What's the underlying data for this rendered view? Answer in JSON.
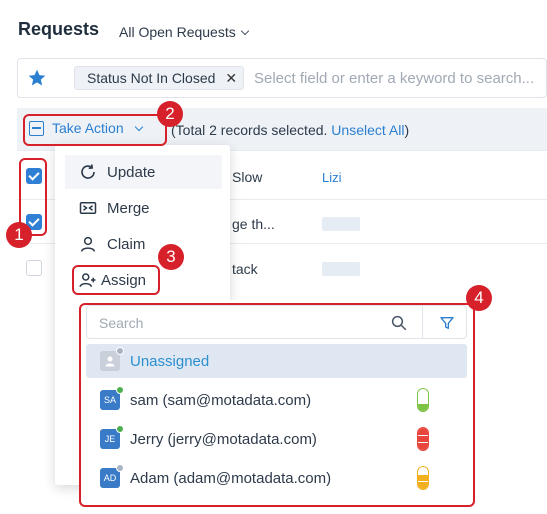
{
  "header": {
    "title": "Requests",
    "filter_label": "All Open Requests"
  },
  "search": {
    "chip_label": "Status Not In Closed",
    "chip_close": "✕",
    "placeholder": "Select field or enter a keyword to search..."
  },
  "action_bar": {
    "take_action_label": "Take Action",
    "records_text": "(Total 2 records selected.",
    "unselect_label": "Unselect All",
    "records_close": ")"
  },
  "rows": [
    {
      "text": "Slow",
      "assignee": "Lizi",
      "checked": true
    },
    {
      "text": "ge th...",
      "assignee": "",
      "checked": true
    },
    {
      "text": "tack",
      "assignee": "",
      "checked": false
    }
  ],
  "menu": {
    "items": [
      {
        "label": "Update",
        "icon": "refresh-icon"
      },
      {
        "label": "Merge",
        "icon": "merge-icon"
      },
      {
        "label": "Claim",
        "icon": "user-icon"
      },
      {
        "label": "Assign",
        "icon": "user-plus-icon"
      }
    ]
  },
  "assign_panel": {
    "search_placeholder": "Search",
    "options": [
      {
        "label": "Unassigned",
        "initials": "",
        "status_color": "#a8b3c4",
        "avatar_color": "#c9d0da",
        "load": null
      },
      {
        "label": "sam (sam@motadata.com)",
        "initials": "SA",
        "status_color": "#4caf50",
        "avatar_color": "#3a7bc8",
        "load": "low"
      },
      {
        "label": "Jerry (jerry@motadata.com)",
        "initials": "JE",
        "status_color": "#4caf50",
        "avatar_color": "#3a7bc8",
        "load": "high"
      },
      {
        "label": "Adam (adam@motadata.com)",
        "initials": "AD",
        "status_color": "#a8b3c4",
        "avatar_color": "#3a7bc8",
        "load": "medium"
      }
    ]
  },
  "callouts": [
    "1",
    "2",
    "3",
    "4"
  ],
  "colors": {
    "accent": "#2b7fd1",
    "callout": "#d6202a",
    "load_low": "#7cc243",
    "load_high": "#e8453c",
    "load_medium": "#f2b01e"
  }
}
